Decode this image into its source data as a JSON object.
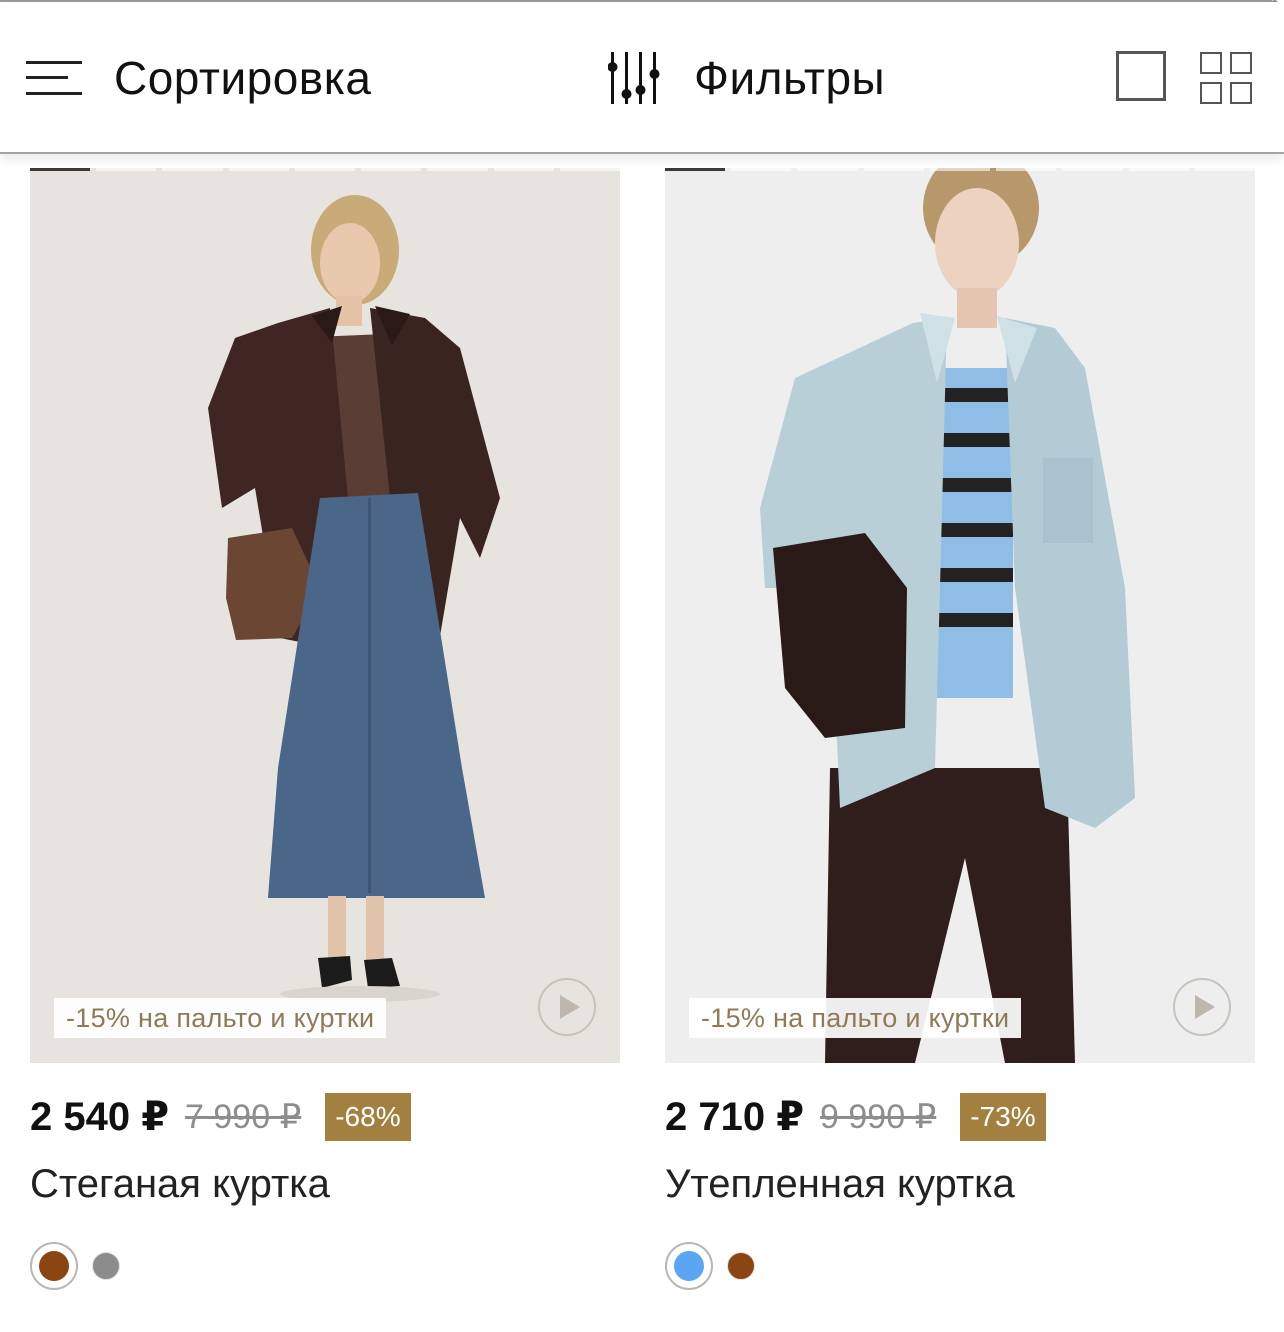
{
  "toolbar": {
    "sort_label": "Сортировка",
    "filters_label": "Фильтры",
    "icons": [
      "menu-lines-icon",
      "sliders-icon",
      "single-view-icon",
      "grid-view-icon"
    ]
  },
  "products": [
    {
      "promo": "-15% на пальто и куртки",
      "price": "2 540 ₽",
      "old_price": "7 990 ₽",
      "discount": "-68%",
      "name": "Стеганая куртка",
      "colors": [
        "#8b4513",
        "#8c8c8c"
      ]
    },
    {
      "promo": "-15% на пальто и куртки",
      "price": "2 710 ₽",
      "old_price": "9 990 ₽",
      "discount": "-73%",
      "name": "Утепленная куртка",
      "colors": [
        "#5aa6f2",
        "#8b4513"
      ]
    }
  ],
  "colors": {
    "discount_bg": "#a3803f",
    "promo_text": "#8e7a56"
  }
}
